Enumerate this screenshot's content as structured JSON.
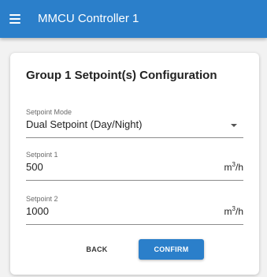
{
  "appbar": {
    "title": "MMCU Controller 1",
    "menu_icon": "hamburger-menu-icon",
    "color": "#2b7fca"
  },
  "card": {
    "title": "Group 1 Setpoint(s) Configuration"
  },
  "setpoint_mode": {
    "label": "Setpoint Mode",
    "value": "Dual Setpoint (Day/Night)"
  },
  "setpoint1": {
    "label": "Setpoint 1",
    "value": "500",
    "unit_base": "m",
    "unit_sup": "3",
    "unit_tail": "/h"
  },
  "setpoint2": {
    "label": "Setpoint 2",
    "value": "1000",
    "unit_base": "m",
    "unit_sup": "3",
    "unit_tail": "/h"
  },
  "actions": {
    "back": "BACK",
    "confirm": "CONFIRM"
  }
}
